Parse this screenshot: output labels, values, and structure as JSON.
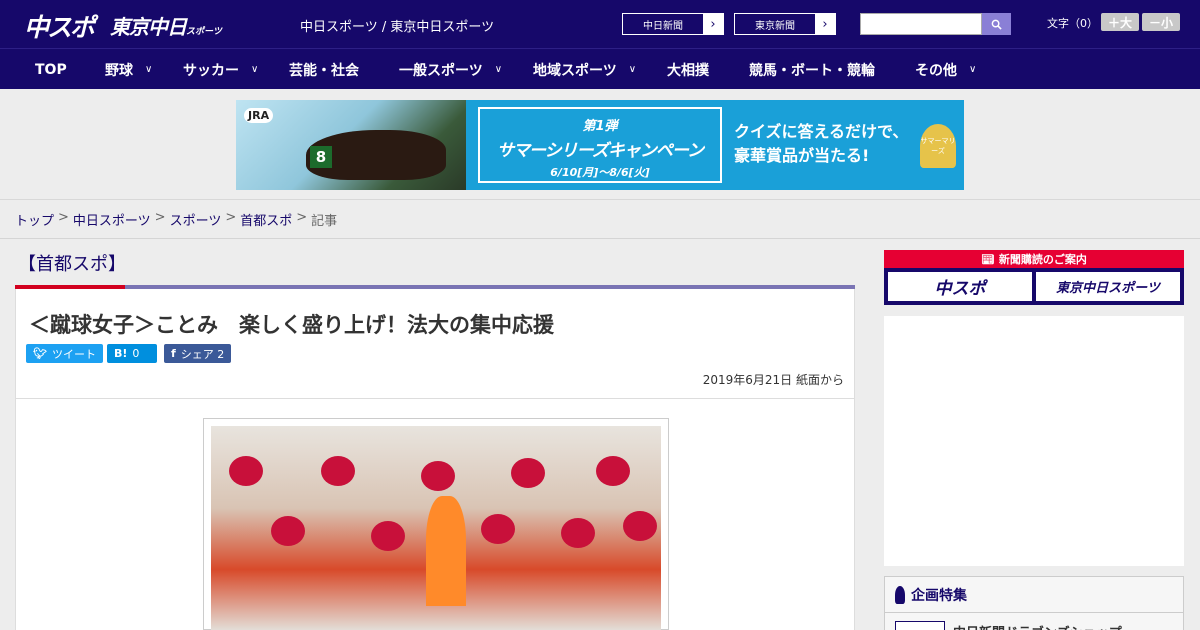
{
  "header": {
    "logo_primary": "中スポ",
    "logo_secondary": "東京中日",
    "logo_secondary_small": "スポーツ",
    "tagline": "中日スポーツ / 東京中日スポーツ",
    "links": [
      {
        "label": "中日新聞"
      },
      {
        "label": "東京新聞"
      }
    ],
    "search_placeholder": "",
    "font_size_label": "文字（0）",
    "font_bigger": "＋大",
    "font_smaller": "－小"
  },
  "nav": [
    {
      "label": "TOP",
      "dropdown": false
    },
    {
      "label": "野球",
      "dropdown": true
    },
    {
      "label": "サッカー",
      "dropdown": true
    },
    {
      "label": "芸能・社会",
      "dropdown": false
    },
    {
      "label": "一般スポーツ",
      "dropdown": true
    },
    {
      "label": "地域スポーツ",
      "dropdown": true
    },
    {
      "label": "大相撲",
      "dropdown": false
    },
    {
      "label": "競馬・ボート・競輪",
      "dropdown": false
    },
    {
      "label": "その他",
      "dropdown": true
    }
  ],
  "banner": {
    "brand": "JRA",
    "number": "8",
    "campaign_line1": "第1弾",
    "campaign_line2": "サマーシリーズキャンペーン",
    "campaign_line3": "6/10[月]～8/6[火]",
    "quiz_line1": "クイズに答えるだけで、",
    "quiz_line2": "豪華賞品が当たる!",
    "trophy_text": "サマーマリーズ"
  },
  "breadcrumb": [
    {
      "label": "トップ",
      "link": true
    },
    {
      "label": "中日スポーツ",
      "link": true
    },
    {
      "label": "スポーツ",
      "link": true
    },
    {
      "label": "首都スポ",
      "link": true
    },
    {
      "label": "記事",
      "link": false
    }
  ],
  "section": {
    "title": "【首都スポ】"
  },
  "article": {
    "headline": "＜蹴球女子＞ことみ　楽しく盛り上げ！法大の集中応援",
    "share": {
      "tweet_label": "ツイート",
      "hatena_label": "0",
      "facebook_label": "シェア 2"
    },
    "dateline": "2019年6月21日 紙面から"
  },
  "sidebar": {
    "subscribe_title": "新聞購読のご案内",
    "subscribe_chuspo": "中スポ",
    "subscribe_tokyo": "東京中日スポーツ",
    "feature_title": "企画特集",
    "feature_item": "中日新聞ドラゴンズショップ"
  },
  "colors": {
    "brand_navy": "#16086a",
    "accent_red": "#d2001f",
    "twitter": "#1da1f2",
    "hatena": "#008fde",
    "facebook": "#3b5998"
  }
}
